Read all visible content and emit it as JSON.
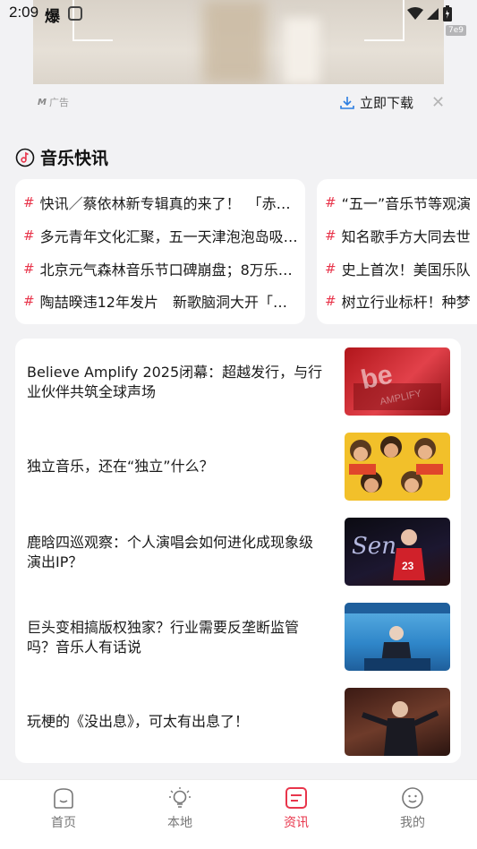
{
  "status_bar": {
    "time": "2:09",
    "app_icon_char": "爆"
  },
  "ad": {
    "badge": "7e9",
    "label": "广告",
    "download_label": "立即下载"
  },
  "music_flash": {
    "title": "音乐快讯",
    "cards": [
      {
        "items": [
          "快讯／蔡依林新专辑真的来了！　「赤…",
          "多元青年文化汇聚，五一天津泡泡岛吸…",
          "北京元气森林音乐节口碑崩盘；8万乐…",
          "陶喆暌违12年发片　新歌脑洞大开「…"
        ]
      },
      {
        "items": [
          "“五一”音乐节等观演",
          "知名歌手方大同去世",
          "史上首次！美国乐队",
          "树立行业标杆！种梦"
        ]
      }
    ]
  },
  "news": {
    "items": [
      {
        "title": "Believe Amplify 2025闭幕：超越发行，与行业伙伴共筑全球声场"
      },
      {
        "title": "独立音乐，还在“独立”什么？"
      },
      {
        "title": "鹿晗四巡观察：个人演唱会如何进化成现象级演出IP？"
      },
      {
        "title": "巨头变相搞版权独家？行业需要反垄断监管吗？音乐人有话说"
      },
      {
        "title": "玩梗的《没出息》，可太有出息了！"
      }
    ]
  },
  "bottom_nav": {
    "tabs": [
      {
        "label": "首页",
        "icon": "home-icon",
        "active": false
      },
      {
        "label": "本地",
        "icon": "lightbulb-icon",
        "active": false
      },
      {
        "label": "资讯",
        "icon": "news-icon",
        "active": true
      },
      {
        "label": "我的",
        "icon": "profile-icon",
        "active": false
      }
    ]
  },
  "colors": {
    "accent": "#e8354b",
    "background": "#f2f2f4",
    "card": "#ffffff"
  }
}
